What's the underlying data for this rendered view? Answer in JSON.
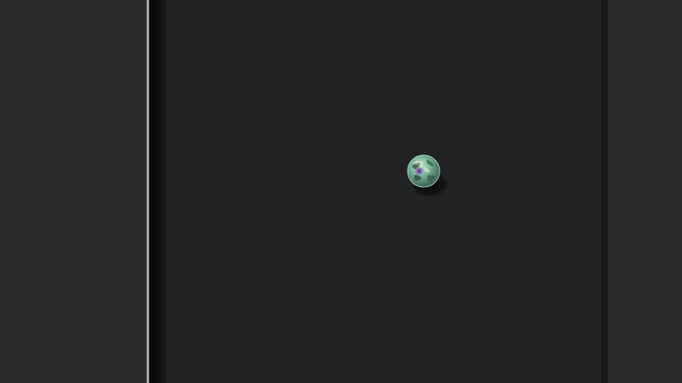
{
  "screen": {
    "background": "#2b2b2b",
    "viewport_background": "#222325"
  },
  "object": {
    "icon": "marble-ball-icon",
    "colors": [
      "#6fbf9a",
      "#3a6d58",
      "#8c6fb8",
      "#d9ead6"
    ]
  }
}
